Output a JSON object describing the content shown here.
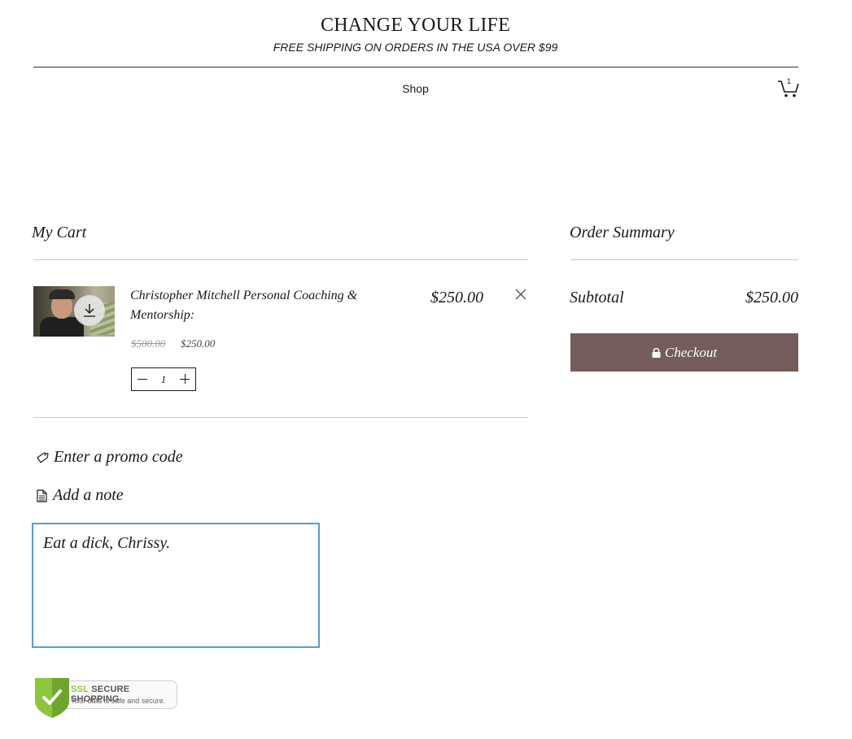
{
  "header": {
    "site_title": "CHANGE YOUR LIFE",
    "shipping_note": "FREE SHIPPING ON ORDERS IN THE USA OVER $99",
    "nav_shop": "Shop",
    "cart_count": "1"
  },
  "cart": {
    "title": "My Cart",
    "item": {
      "name": "Christopher Mitchell Personal Coaching & Mentorship:",
      "original_price": "$500.00",
      "sale_price": "$250.00",
      "quantity": "1",
      "line_total": "$250.00"
    },
    "promo_label": "Enter a promo code",
    "note_label": "Add a note",
    "note_value": "Eat a dick, Chrissy."
  },
  "summary": {
    "title": "Order Summary",
    "subtotal_label": "Subtotal",
    "subtotal_value": "$250.00",
    "checkout_label": "Checkout"
  },
  "badge": {
    "ssl": "SSL",
    "title": "SECURE SHOPPING",
    "subtitle": "Your data is safe and secure."
  },
  "colors": {
    "checkout_bg": "#735c5b",
    "note_border": "#5b9bd1",
    "ssl_green": "#8cc63f"
  },
  "icons": [
    "cart-icon",
    "download-icon",
    "close-icon",
    "tag-icon",
    "note-icon",
    "lock-icon",
    "shield-check-icon"
  ]
}
